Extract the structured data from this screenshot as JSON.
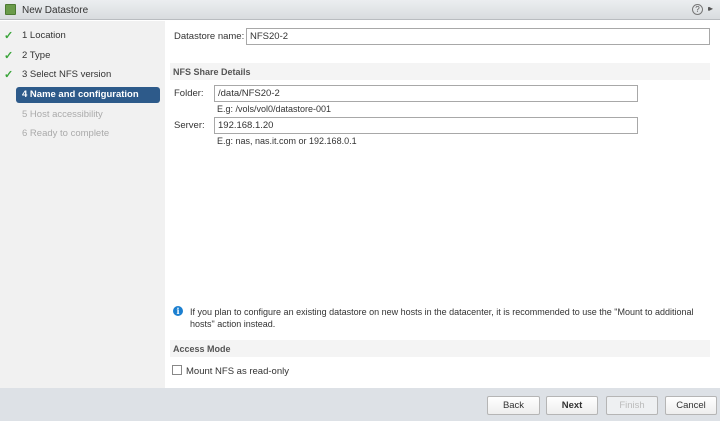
{
  "window": {
    "title": "New Datastore",
    "help_icon": "?",
    "expand_icon": "▸▸"
  },
  "steps": [
    {
      "label": "1  Location",
      "state": "done"
    },
    {
      "label": "2  Type",
      "state": "done"
    },
    {
      "label": "3  Select NFS version",
      "state": "done"
    },
    {
      "label": "4  Name and configuration",
      "state": "current"
    },
    {
      "label": "5  Host accessibility",
      "state": "todo"
    },
    {
      "label": "6  Ready to complete",
      "state": "todo"
    }
  ],
  "form": {
    "datastore_name_label": "Datastore name:",
    "datastore_name_value": "NFS20-2",
    "nfs_section": "NFS Share Details",
    "folder_label": "Folder:",
    "folder_value": "/data/NFS20-2",
    "folder_hint": "E.g: /vols/vol0/datastore-001",
    "server_label": "Server:",
    "server_value": "192.168.1.20",
    "server_hint": "E.g: nas, nas.it.com or 192.168.0.1",
    "info_line1": "If you plan to configure an existing datastore on new hosts in the datacenter, it is recommended to use the \"Mount to additional",
    "info_line2": "hosts\" action instead.",
    "access_section": "Access Mode",
    "readonly_label": "Mount NFS as read-only",
    "readonly_checked": false
  },
  "buttons": {
    "back": "Back",
    "next": "Next",
    "finish": "Finish",
    "cancel": "Cancel"
  },
  "colors": {
    "accent": "#2d5a8a",
    "check": "#3aa53a",
    "info": "#1b7fd0"
  }
}
